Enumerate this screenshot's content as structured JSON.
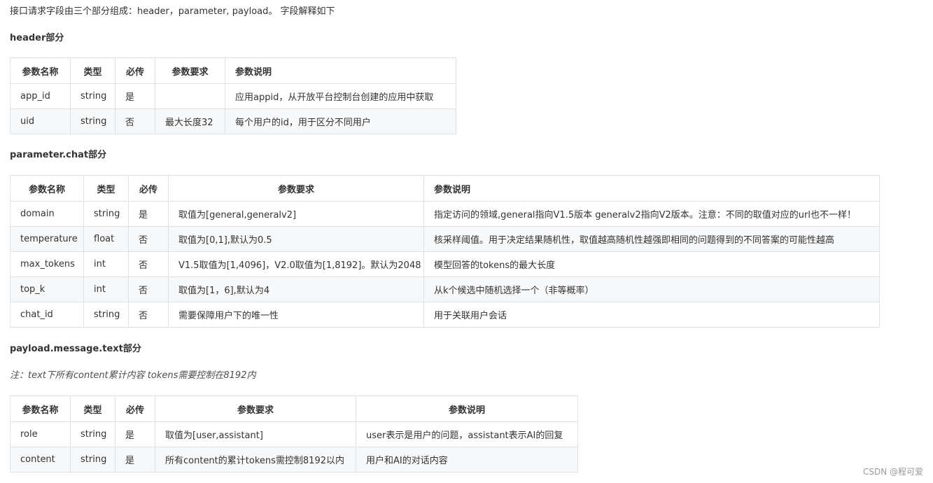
{
  "intro": "接口请求字段由三个部分组成：header，parameter, payload。 字段解释如下",
  "sections": {
    "header": {
      "title": "header部分",
      "columns": [
        "参数名称",
        "类型",
        "必传",
        "参数要求",
        "参数说明"
      ],
      "rows": [
        [
          "app_id",
          "string",
          "是",
          "",
          "应用appid，从开放平台控制台创建的应用中获取"
        ],
        [
          "uid",
          "string",
          "否",
          "最大长度32",
          "每个用户的id，用于区分不同用户"
        ]
      ]
    },
    "parameter": {
      "title": "parameter.chat部分",
      "columns": [
        "参数名称",
        "类型",
        "必传",
        "参数要求",
        "参数说明"
      ],
      "rows": [
        [
          "domain",
          "string",
          "是",
          "取值为[general,generalv2]",
          "指定访问的领域,general指向V1.5版本 generalv2指向V2版本。注意：不同的取值对应的url也不一样！"
        ],
        [
          "temperature",
          "float",
          "否",
          "取值为[0,1],默认为0.5",
          "核采样阈值。用于决定结果随机性，取值越高随机性越强即相同的问题得到的不同答案的可能性越高"
        ],
        [
          "max_tokens",
          "int",
          "否",
          "V1.5取值为[1,4096]，V2.0取值为[1,8192]。默认为2048",
          "模型回答的tokens的最大长度"
        ],
        [
          "top_k",
          "int",
          "否",
          "取值为[1，6],默认为4",
          "从k个候选中随机选择一个（非等概率）"
        ],
        [
          "chat_id",
          "string",
          "否",
          "需要保障用户下的唯一性",
          "用于关联用户会话"
        ]
      ]
    },
    "payload": {
      "title": "payload.message.text部分",
      "note": "注：text下所有content累计内容 tokens需要控制在8192内",
      "columns": [
        "参数名称",
        "类型",
        "必传",
        "参数要求",
        "参数说明"
      ],
      "rows": [
        [
          "role",
          "string",
          "是",
          "取值为[user,assistant]",
          "user表示是用户的问题，assistant表示AI的回复"
        ],
        [
          "content",
          "string",
          "是",
          "所有content的累计tokens需控制8192以内",
          "用户和AI的对话内容"
        ]
      ]
    }
  },
  "watermark": "CSDN @程可爱"
}
